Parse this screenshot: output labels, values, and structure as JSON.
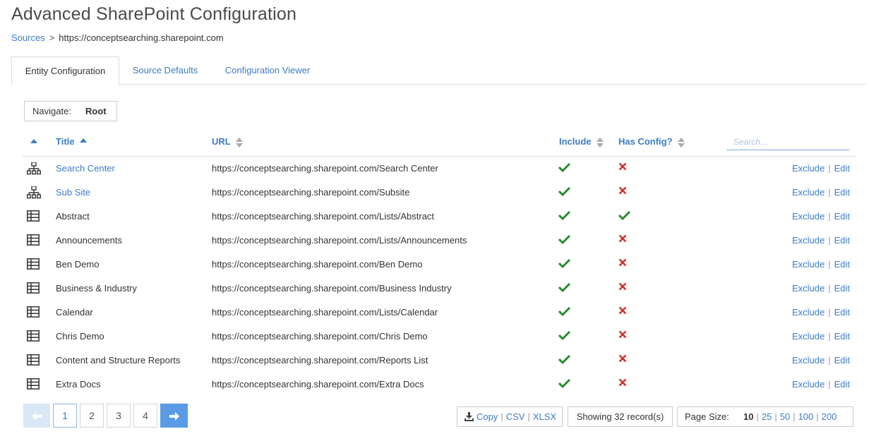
{
  "header": {
    "title": "Advanced SharePoint Configuration"
  },
  "breadcrumb": {
    "parent": "Sources",
    "separator": ">",
    "current": "https://conceptsearching.sharepoint.com"
  },
  "tabs": [
    {
      "label": "Entity Configuration",
      "active": true
    },
    {
      "label": "Source Defaults",
      "active": false
    },
    {
      "label": "Configuration Viewer",
      "active": false
    }
  ],
  "navigate": {
    "label": "Navigate:",
    "value": "Root"
  },
  "table": {
    "columns": {
      "title": "Title",
      "url": "URL",
      "include": "Include",
      "has_config": "Has Config?"
    },
    "search_placeholder": "Search...",
    "exclude_label": "Exclude",
    "edit_label": "Edit",
    "rows": [
      {
        "icon": "site-icon",
        "title": "Search Center",
        "title_link": true,
        "url": "https://conceptsearching.sharepoint.com/Search Center",
        "include": true,
        "has_config": false
      },
      {
        "icon": "site-icon",
        "title": "Sub Site",
        "title_link": true,
        "url": "https://conceptsearching.sharepoint.com/Subsite",
        "include": true,
        "has_config": false
      },
      {
        "icon": "list-icon",
        "title": "Abstract",
        "title_link": false,
        "url": "https://conceptsearching.sharepoint.com/Lists/Abstract",
        "include": true,
        "has_config": true
      },
      {
        "icon": "list-icon",
        "title": "Announcements",
        "title_link": false,
        "url": "https://conceptsearching.sharepoint.com/Lists/Announcements",
        "include": true,
        "has_config": false
      },
      {
        "icon": "list-icon",
        "title": "Ben Demo",
        "title_link": false,
        "url": "https://conceptsearching.sharepoint.com/Ben Demo",
        "include": true,
        "has_config": false
      },
      {
        "icon": "list-icon",
        "title": "Business & Industry",
        "title_link": false,
        "url": "https://conceptsearching.sharepoint.com/Business Industry",
        "include": true,
        "has_config": false
      },
      {
        "icon": "list-icon",
        "title": "Calendar",
        "title_link": false,
        "url": "https://conceptsearching.sharepoint.com/Lists/Calendar",
        "include": true,
        "has_config": false
      },
      {
        "icon": "list-icon",
        "title": "Chris Demo",
        "title_link": false,
        "url": "https://conceptsearching.sharepoint.com/Chris Demo",
        "include": true,
        "has_config": false
      },
      {
        "icon": "list-icon",
        "title": "Content and Structure Reports",
        "title_link": false,
        "url": "https://conceptsearching.sharepoint.com/Reports List",
        "include": true,
        "has_config": false
      },
      {
        "icon": "list-icon",
        "title": "Extra Docs",
        "title_link": false,
        "url": "https://conceptsearching.sharepoint.com/Extra Docs",
        "include": true,
        "has_config": false
      }
    ]
  },
  "pagination": {
    "pages": [
      "1",
      "2",
      "3",
      "4"
    ],
    "current": "1"
  },
  "export": {
    "copy": "Copy",
    "csv": "CSV",
    "xlsx": "XLSX"
  },
  "records": {
    "text": "Showing 32 record(s)"
  },
  "page_size": {
    "label": "Page Size:",
    "options": [
      "10",
      "25",
      "50",
      "100",
      "200"
    ],
    "selected": "10"
  },
  "colors": {
    "link": "#3b7dc4",
    "check": "#2e8b2e",
    "cross": "#d13434",
    "primary_button": "#5a9be6"
  }
}
